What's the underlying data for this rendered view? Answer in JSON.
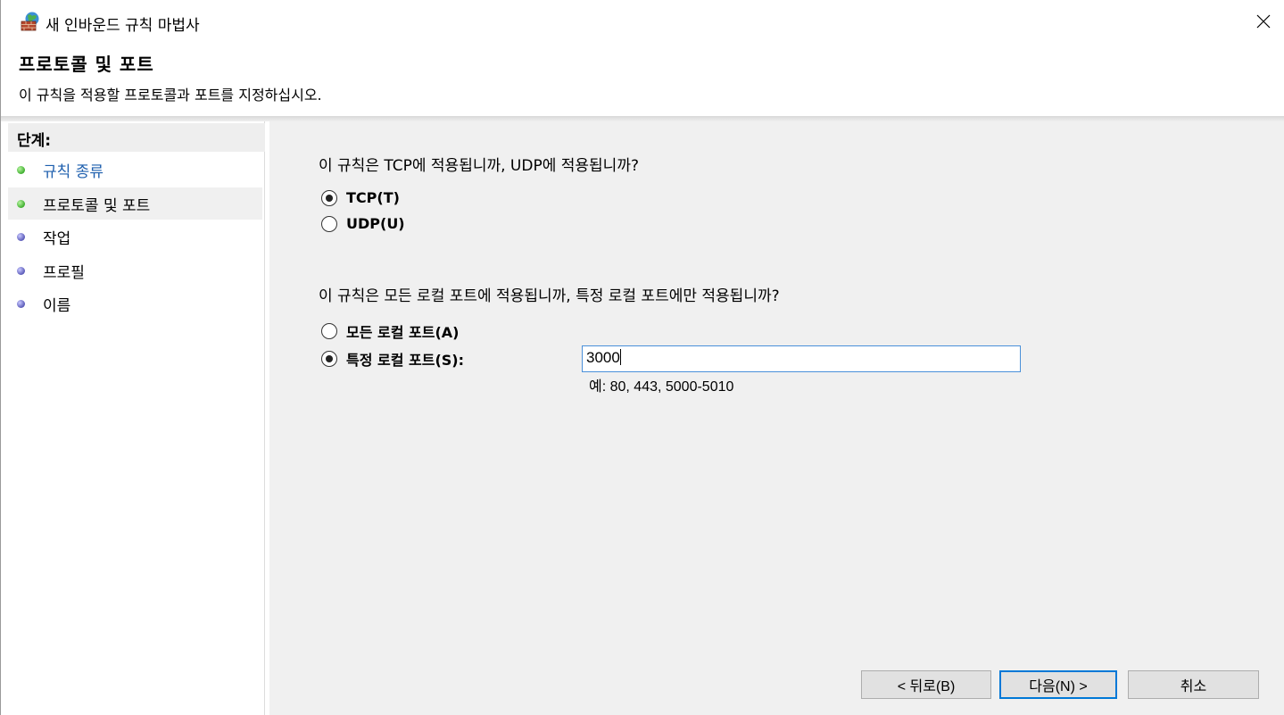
{
  "window": {
    "title": "새 인바운드 규칙 마법사",
    "icons": {
      "app": "firewall-globe-icon",
      "close": "close-icon"
    }
  },
  "header": {
    "title": "프로토콜 및 포트",
    "subtitle": "이 규칙을 적용할 프로토콜과 포트를 지정하십시오."
  },
  "sidebar": {
    "heading": "단계:",
    "steps": [
      {
        "label": "규칙 종류",
        "state": "completed-link",
        "dot": "green"
      },
      {
        "label": "프로토콜 및 포트",
        "state": "current",
        "dot": "green"
      },
      {
        "label": "작업",
        "state": "pending",
        "dot": "purple"
      },
      {
        "label": "프로필",
        "state": "pending",
        "dot": "purple"
      },
      {
        "label": "이름",
        "state": "pending",
        "dot": "purple"
      }
    ]
  },
  "protocol": {
    "question": "이 규칙은 TCP에 적용됩니까, UDP에 적용됩니까?",
    "options": [
      {
        "label": "TCP(T)",
        "selected": true
      },
      {
        "label": "UDP(U)",
        "selected": false
      }
    ]
  },
  "ports": {
    "question": "이 규칙은 모든 로컬 포트에 적용됩니까, 특정 로컬 포트에만 적용됩니까?",
    "options": [
      {
        "label": "모든 로컬 포트(A)",
        "selected": false
      },
      {
        "label": "특정 로컬 포트(S):",
        "selected": true
      }
    ],
    "input_value": "3000",
    "example": "예: 80, 443, 5000-5010"
  },
  "buttons": {
    "back": "< 뒤로(B)",
    "next": "다음(N) >",
    "cancel": "취소"
  },
  "colors": {
    "link": "#1e5fae",
    "content_bg": "#f0f0f0",
    "focus_border": "#0078d7"
  }
}
